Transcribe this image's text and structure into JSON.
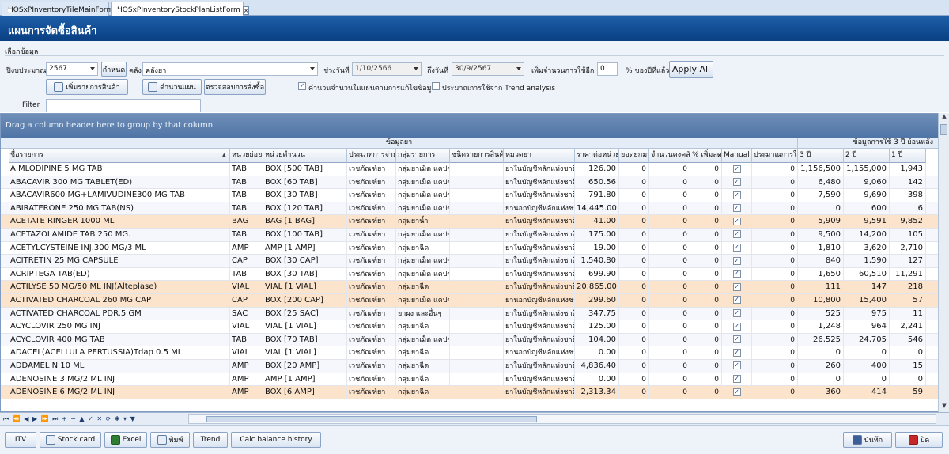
{
  "tabs": [
    {
      "label": "HOSxPInventoryTileMainForm"
    },
    {
      "label": "HOSxPInventoryStockPlanListForm"
    }
  ],
  "tab_close": "×",
  "page_title": "แผนการจัดซื้อสินค้า",
  "filter": {
    "group_title": "เลือกข้อมูล",
    "budget_year_label": "ปีงบประมาณ",
    "budget_year": "2567",
    "define_button": "กำหนด",
    "store_label": "คลัง",
    "store_value": "คลังยา",
    "date_from_label": "ช่วงวันที่",
    "date_from": "1/10/2566",
    "date_to_label": "ถึงวันที่",
    "date_to": "30/9/2567",
    "increase_label": "เพิ่มจำนวนการใช้อีก",
    "increase_value": "0",
    "percent_label": "% ของปีที่แล้ว",
    "apply_all": "Apply All",
    "add_items_button": "เพิ่มรายการสินค้า",
    "calc_plan_button": "คำนวนแผน",
    "check_order_button": "ตรวจสอบการสั่งซื้อ",
    "calc_checkbox_label": "คำนวนจำนวนในแผนตามการแก้ไขข้อมูล",
    "calc_checked": true,
    "trend_checkbox_label": "ประมาณการใช้จาก Trend analysis",
    "trend_checked": false,
    "filter_label": "Filter",
    "filter_value": ""
  },
  "grid": {
    "group_hint": "Drag a column header here to group by that column",
    "band_info": "ข้อมูลยา",
    "band_usage": "ข้อมูลการใช้ 3 ปี ย้อนหลัง",
    "columns": {
      "name": "ชื่อรายการ",
      "unit": "หน่วยย่อย",
      "calc_unit": "หน่วยคำนวน",
      "buy_type": "ประเภทการจ่าย",
      "group": "กลุ่มรายการ",
      "item_type": "ชนิดรายการสินค้า",
      "category": "หมวดยา",
      "unit_price": "ราคาต่อหน่วย",
      "balance": "ยอดยกมา",
      "stock": "จำนวนคงคลัง",
      "pct": "% เพิ่มลด",
      "manual": "Manual",
      "estimate": "ประมาณการใช้",
      "y3": "3 ปี",
      "y2": "2 ปี",
      "y1": "1 ปี"
    },
    "sort_indicator": "▲",
    "rows": [
      {
        "name": "A MLODIPINE 5 MG TAB",
        "unit": "TAB",
        "calc_unit": "BOX [500 TAB]",
        "buy_type": "เวชภัณฑ์ยา",
        "group": "กลุ่มยาเม็ด แคปซูล",
        "item_type": "",
        "category": "ยาในบัญชีหลักแห่งชาติ",
        "unit_price": "126.00",
        "balance": "0",
        "stock": "0",
        "pct": "0",
        "manual": true,
        "estimate": "0",
        "y3": "1,156,500",
        "y2": "1,155,000",
        "y1": "1,943",
        "hl": false
      },
      {
        "name": "ABACAVIR 300 MG TABLET(ED)",
        "unit": "TAB",
        "calc_unit": "BOX [60 TAB]",
        "buy_type": "เวชภัณฑ์ยา",
        "group": "กลุ่มยาเม็ด แคปซูล",
        "item_type": "",
        "category": "ยาในบัญชีหลักแห่งชาติ",
        "unit_price": "650.56",
        "balance": "0",
        "stock": "0",
        "pct": "0",
        "manual": true,
        "estimate": "0",
        "y3": "6,480",
        "y2": "9,060",
        "y1": "142",
        "hl": false
      },
      {
        "name": "ABACAVIR600 MG+LAMIVUDINE300 MG TAB",
        "unit": "TAB",
        "calc_unit": "BOX [30 TAB]",
        "buy_type": "เวชภัณฑ์ยา",
        "group": "กลุ่มยาเม็ด แคปซูล",
        "item_type": "",
        "category": "ยาในบัญชีหลักแห่งชาติ",
        "unit_price": "791.80",
        "balance": "0",
        "stock": "0",
        "pct": "0",
        "manual": true,
        "estimate": "0",
        "y3": "7,590",
        "y2": "9,690",
        "y1": "398",
        "hl": false
      },
      {
        "name": "ABIRATERONE 250 MG TAB(NS)",
        "unit": "TAB",
        "calc_unit": "BOX [120 TAB]",
        "buy_type": "เวชภัณฑ์ยา",
        "group": "กลุ่มยาเม็ด แคปซูล",
        "item_type": "",
        "category": "ยานอกบัญชีหลักแห่งชาติ",
        "unit_price": "14,445.00",
        "balance": "0",
        "stock": "0",
        "pct": "0",
        "manual": true,
        "estimate": "0",
        "y3": "0",
        "y2": "600",
        "y1": "6",
        "hl": false
      },
      {
        "name": "ACETATE RINGER 1000 ML",
        "unit": "BAG",
        "calc_unit": "BAG [1 BAG]",
        "buy_type": "เวชภัณฑ์ยา",
        "group": "กลุ่มยาน้ำ",
        "item_type": "",
        "category": "ยาในบัญชีหลักแห่งชาติ",
        "unit_price": "41.00",
        "balance": "0",
        "stock": "0",
        "pct": "0",
        "manual": true,
        "estimate": "0",
        "y3": "5,909",
        "y2": "9,591",
        "y1": "9,852",
        "hl": true
      },
      {
        "name": "ACETAZOLAMIDE TAB 250 MG.",
        "unit": "TAB",
        "calc_unit": "BOX [100 TAB]",
        "buy_type": "เวชภัณฑ์ยา",
        "group": "กลุ่มยาเม็ด แคปซูล",
        "item_type": "",
        "category": "ยาในบัญชีหลักแห่งชาติ",
        "unit_price": "175.00",
        "balance": "0",
        "stock": "0",
        "pct": "0",
        "manual": true,
        "estimate": "0",
        "y3": "9,500",
        "y2": "14,200",
        "y1": "105",
        "hl": false
      },
      {
        "name": "ACETYLCYSTEINE INJ.300 MG/3 ML",
        "unit": "AMP",
        "calc_unit": "AMP [1 AMP]",
        "buy_type": "เวชภัณฑ์ยา",
        "group": "กลุ่มยาฉีด",
        "item_type": "",
        "category": "ยาในบัญชีหลักแห่งชาติ",
        "unit_price": "19.00",
        "balance": "0",
        "stock": "0",
        "pct": "0",
        "manual": true,
        "estimate": "0",
        "y3": "1,810",
        "y2": "3,620",
        "y1": "2,710",
        "hl": false
      },
      {
        "name": "ACITRETIN 25 MG CAPSULE",
        "unit": "CAP",
        "calc_unit": "BOX [30 CAP]",
        "buy_type": "เวชภัณฑ์ยา",
        "group": "กลุ่มยาเม็ด แคปซูล",
        "item_type": "",
        "category": "ยาในบัญชีหลักแห่งชาติ",
        "unit_price": "1,540.80",
        "balance": "0",
        "stock": "0",
        "pct": "0",
        "manual": true,
        "estimate": "0",
        "y3": "840",
        "y2": "1,590",
        "y1": "127",
        "hl": false
      },
      {
        "name": "ACRIPTEGA TAB(ED)",
        "unit": "TAB",
        "calc_unit": "BOX [30 TAB]",
        "buy_type": "เวชภัณฑ์ยา",
        "group": "กลุ่มยาเม็ด แคปซูล",
        "item_type": "",
        "category": "ยาในบัญชีหลักแห่งชาติ",
        "unit_price": "699.90",
        "balance": "0",
        "stock": "0",
        "pct": "0",
        "manual": true,
        "estimate": "0",
        "y3": "1,650",
        "y2": "60,510",
        "y1": "11,291",
        "hl": false
      },
      {
        "name": "ACTILYSE 50 MG/50 ML INJ(Alteplase)",
        "unit": "VIAL",
        "calc_unit": "VIAL [1 VIAL]",
        "buy_type": "เวชภัณฑ์ยา",
        "group": "กลุ่มยาฉีด",
        "item_type": "",
        "category": "ยาในบัญชีหลักแห่งชาติ",
        "unit_price": "20,865.00",
        "balance": "0",
        "stock": "0",
        "pct": "0",
        "manual": true,
        "estimate": "0",
        "y3": "111",
        "y2": "147",
        "y1": "218",
        "hl": true
      },
      {
        "name": "ACTIVATED CHARCOAL 260 MG CAP",
        "unit": "CAP",
        "calc_unit": "BOX [200 CAP]",
        "buy_type": "เวชภัณฑ์ยา",
        "group": "กลุ่มยาเม็ด แคปซูล",
        "item_type": "",
        "category": "ยานอกบัญชีหลักแห่งชาติ",
        "unit_price": "299.60",
        "balance": "0",
        "stock": "0",
        "pct": "0",
        "manual": true,
        "estimate": "0",
        "y3": "10,800",
        "y2": "15,400",
        "y1": "57",
        "hl": true
      },
      {
        "name": "ACTIVATED CHARCOAL PDR.5 GM",
        "unit": "SAC",
        "calc_unit": "BOX [25 SAC]",
        "buy_type": "เวชภัณฑ์ยา",
        "group": "ยาผง และอื่นๆ",
        "item_type": "",
        "category": "ยาในบัญชีหลักแห่งชาติ",
        "unit_price": "347.75",
        "balance": "0",
        "stock": "0",
        "pct": "0",
        "manual": true,
        "estimate": "0",
        "y3": "525",
        "y2": "975",
        "y1": "11",
        "hl": false
      },
      {
        "name": "ACYCLOVIR 250 MG INJ",
        "unit": "VIAL",
        "calc_unit": "VIAL [1 VIAL]",
        "buy_type": "เวชภัณฑ์ยา",
        "group": "กลุ่มยาฉีด",
        "item_type": "",
        "category": "ยาในบัญชีหลักแห่งชาติ",
        "unit_price": "125.00",
        "balance": "0",
        "stock": "0",
        "pct": "0",
        "manual": true,
        "estimate": "0",
        "y3": "1,248",
        "y2": "964",
        "y1": "2,241",
        "hl": false
      },
      {
        "name": "ACYCLOVIR 400 MG TAB",
        "unit": "TAB",
        "calc_unit": "BOX [70 TAB]",
        "buy_type": "เวชภัณฑ์ยา",
        "group": "กลุ่มยาเม็ด แคปซูล",
        "item_type": "",
        "category": "ยาในบัญชีหลักแห่งชาติ",
        "unit_price": "104.00",
        "balance": "0",
        "stock": "0",
        "pct": "0",
        "manual": true,
        "estimate": "0",
        "y3": "26,525",
        "y2": "24,705",
        "y1": "546",
        "hl": false
      },
      {
        "name": "ADACEL(ACELLULA PERTUSSIA)Tdap 0.5 ML",
        "unit": "VIAL",
        "calc_unit": "VIAL [1 VIAL]",
        "buy_type": "เวชภัณฑ์ยา",
        "group": "กลุ่มยาฉีด",
        "item_type": "",
        "category": "ยานอกบัญชีหลักแห่งชาติ",
        "unit_price": "0.00",
        "balance": "0",
        "stock": "0",
        "pct": "0",
        "manual": true,
        "estimate": "0",
        "y3": "0",
        "y2": "0",
        "y1": "0",
        "hl": false
      },
      {
        "name": "ADDAMEL N 10 ML",
        "unit": "AMP",
        "calc_unit": "BOX [20 AMP]",
        "buy_type": "เวชภัณฑ์ยา",
        "group": "กลุ่มยาฉีด",
        "item_type": "",
        "category": "ยาในบัญชีหลักแห่งชาติ",
        "unit_price": "4,836.40",
        "balance": "0",
        "stock": "0",
        "pct": "0",
        "manual": true,
        "estimate": "0",
        "y3": "260",
        "y2": "400",
        "y1": "15",
        "hl": false
      },
      {
        "name": "ADENOSINE 3 MG/2 ML INJ",
        "unit": "AMP",
        "calc_unit": "AMP [1 AMP]",
        "buy_type": "เวชภัณฑ์ยา",
        "group": "กลุ่มยาฉีด",
        "item_type": "",
        "category": "ยาในบัญชีหลักแห่งชาติ",
        "unit_price": "0.00",
        "balance": "0",
        "stock": "0",
        "pct": "0",
        "manual": true,
        "estimate": "0",
        "y3": "0",
        "y2": "0",
        "y1": "0",
        "hl": false
      },
      {
        "name": "ADENOSINE 6 MG/2 ML INJ",
        "unit": "AMP",
        "calc_unit": "BOX [6 AMP]",
        "buy_type": "เวชภัณฑ์ยา",
        "group": "กลุ่มยาฉีด",
        "item_type": "",
        "category": "ยาในบัญชีหลักแห่งชาติ",
        "unit_price": "2,313.34",
        "balance": "0",
        "stock": "0",
        "pct": "0",
        "manual": true,
        "estimate": "0",
        "y3": "360",
        "y2": "414",
        "y1": "59",
        "hl": true
      }
    ]
  },
  "navigator": {
    "buttons": "⏮ ⏪ ◀ ▶ ⏩ ⏭ + − ▲ ✓ ✕ ⟳ ✱ ▾ ▼"
  },
  "footer": {
    "itv": "ITV",
    "stock_card": "Stock card",
    "excel": "Excel",
    "print": "พิมพ์",
    "trend": "Trend",
    "calc_balance": "Calc balance history",
    "save": "บันทึก",
    "close": "ปิด"
  }
}
